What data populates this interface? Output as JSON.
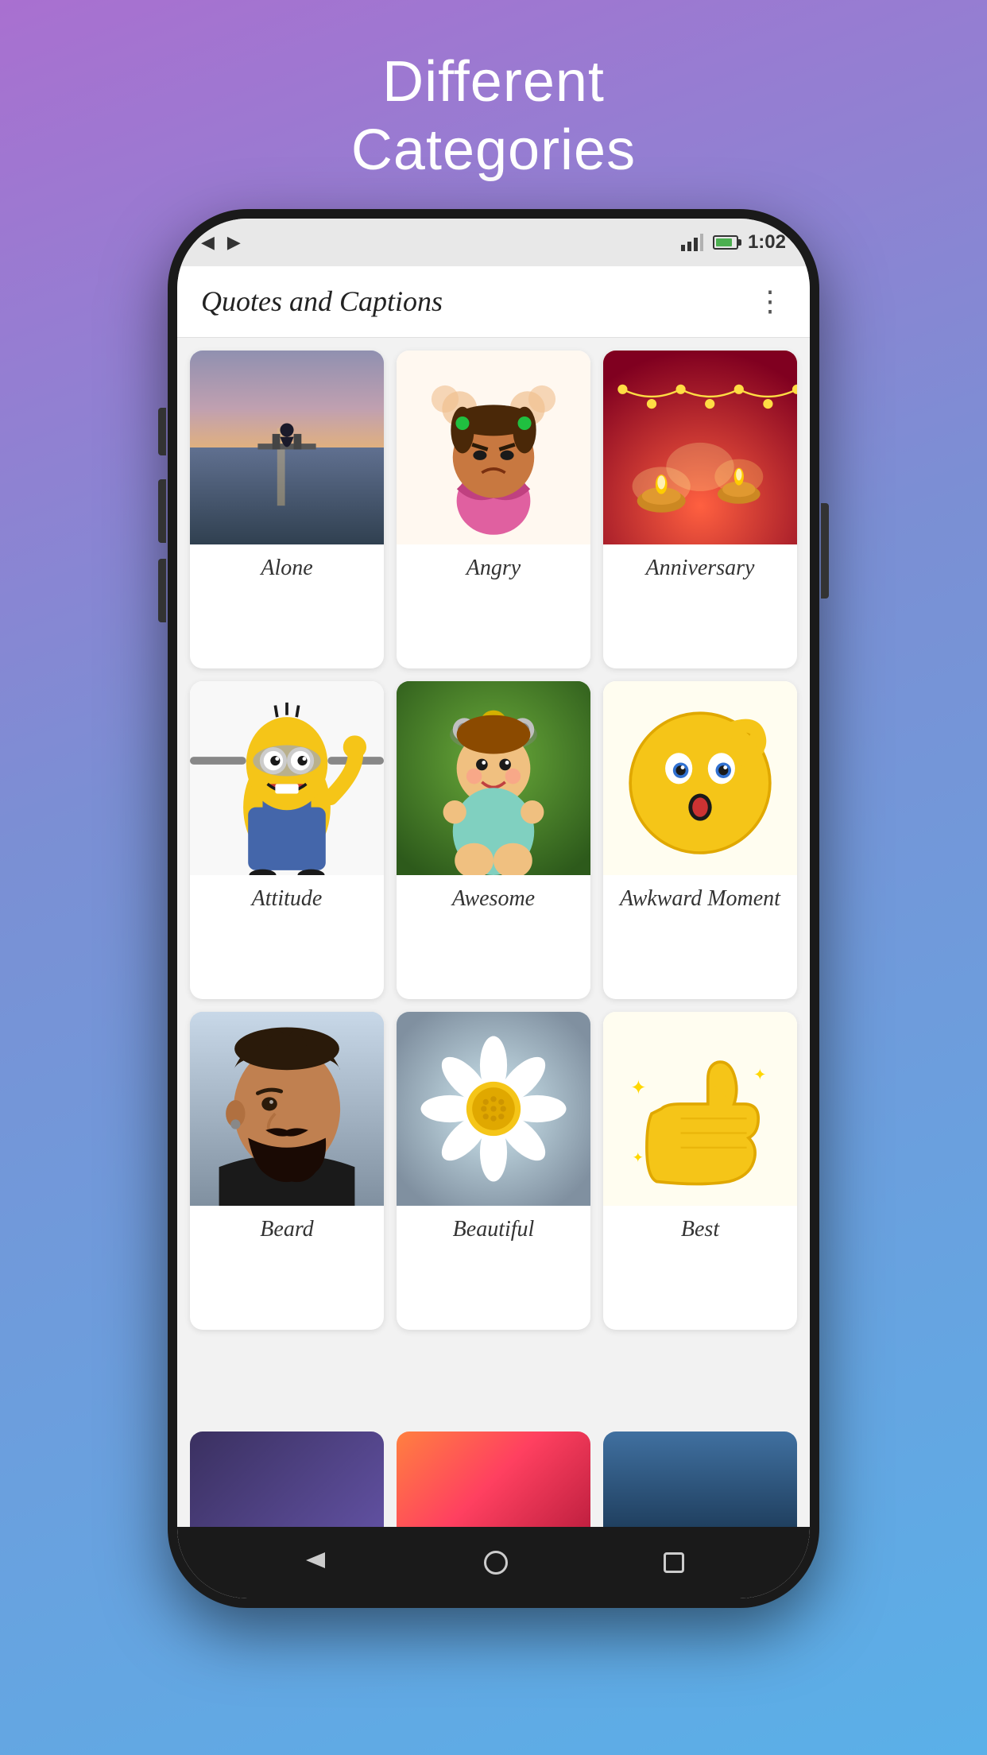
{
  "header": {
    "title": "Different\nCategories",
    "color": "#ffffff"
  },
  "statusBar": {
    "time": "1:02",
    "icons": [
      "signal",
      "battery"
    ]
  },
  "appBar": {
    "title": "Quotes and Captions",
    "menuIcon": "⋮"
  },
  "categories": [
    {
      "id": "alone",
      "label": "Alone",
      "imageType": "alone"
    },
    {
      "id": "angry",
      "label": "Angry",
      "imageType": "angry"
    },
    {
      "id": "anniversary",
      "label": "Anniversary",
      "imageType": "anniversary"
    },
    {
      "id": "attitude",
      "label": "Attitude",
      "imageType": "attitude"
    },
    {
      "id": "awesome",
      "label": "Awesome",
      "imageType": "awesome"
    },
    {
      "id": "awkward",
      "label": "Awkward Moment",
      "imageType": "awkward"
    },
    {
      "id": "beard",
      "label": "Beard",
      "imageType": "beard"
    },
    {
      "id": "beautiful",
      "label": "Beautiful",
      "imageType": "beautiful"
    },
    {
      "id": "best",
      "label": "Best",
      "imageType": "best"
    }
  ],
  "partialCategories": [
    {
      "id": "partial1",
      "imageType": "dark"
    },
    {
      "id": "partial2",
      "imageType": "sunset"
    },
    {
      "id": "partial3",
      "imageType": "silhouette"
    }
  ],
  "bottomNav": {
    "backIcon": "◁",
    "homeIcon": "○",
    "recentIcon": "□"
  }
}
